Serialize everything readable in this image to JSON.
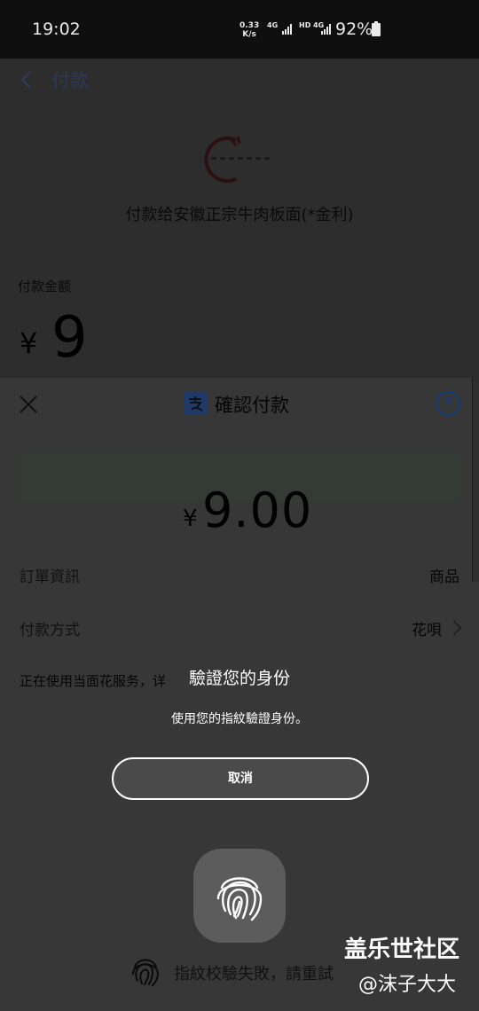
{
  "status_bar": {
    "time": "19:02",
    "speed_value": "0.33",
    "speed_unit": "K/s",
    "net1": "4G",
    "hd": "HD",
    "net2": "4G",
    "battery": "92%"
  },
  "payment_page": {
    "title": "付款",
    "merchant": "付款给安徽正宗牛肉板面(*金利)",
    "amount_label": "付款金额",
    "currency": "¥",
    "amount": "9"
  },
  "confirm_sheet": {
    "title": "確認付款",
    "help": "?",
    "currency": "¥",
    "amount": "9.00",
    "order_label": "訂單資訊",
    "order_value": "商品",
    "method_label": "付款方式",
    "method_value": "花唄",
    "notice": "正在使用当面花服务，详"
  },
  "biometric": {
    "title": "驗證您的身份",
    "subtitle": "使用您的指紋驗證身份。",
    "cancel": "取消",
    "fail_message": "指紋校驗失敗，請重試"
  },
  "watermark": {
    "line1": "盖乐世社区",
    "line2": "@沫子大大"
  },
  "colors": {
    "dialog_text": "#ffffff",
    "sheet_bg": "#373737",
    "alipay_blue": "#1d3a6b"
  }
}
